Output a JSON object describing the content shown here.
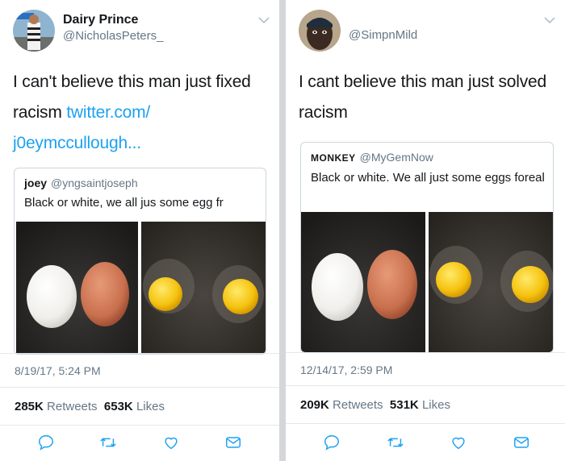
{
  "left": {
    "author": {
      "name": "Dairy Prince",
      "handle": "@NicholasPeters_"
    },
    "text": "I can't believe this man just fixed racism",
    "link_line1": "twitter.com/",
    "link_line2": "j0eymccullough...",
    "quote": {
      "name": "joey",
      "handle": "@yngsaintjoseph",
      "text": "Black or white, we all jus some egg fr"
    },
    "timestamp": "8/19/17, 5:24 PM",
    "retweets_count": "285K",
    "retweets_label": "Retweets",
    "likes_count": "653K",
    "likes_label": "Likes"
  },
  "right": {
    "author": {
      "name": "",
      "handle": "@SimpnMild"
    },
    "text": "I cant believe this man just solved racism",
    "quote": {
      "name": "MONKEY",
      "handle": "@MyGemNow",
      "text": "Black or white. We all just some eggs foreal"
    },
    "timestamp": "12/14/17, 2:59 PM",
    "retweets_count": "209K",
    "retweets_label": "Retweets",
    "likes_count": "531K",
    "likes_label": "Likes"
  },
  "colors": {
    "link": "#1da1f2",
    "secondary_text": "#657786",
    "divider": "#d4d6d9"
  },
  "icons": [
    "reply-icon",
    "retweet-icon",
    "like-icon",
    "direct-message-icon",
    "chevron-down-icon"
  ]
}
